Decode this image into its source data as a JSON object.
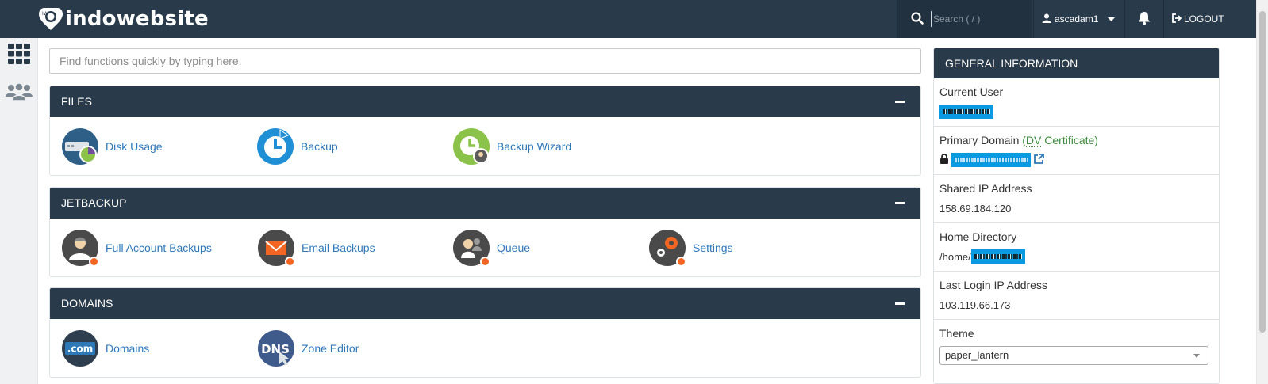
{
  "brand": {
    "name": "indowebsite",
    "mark": "IW"
  },
  "topbar": {
    "search_placeholder": "Search ( / )",
    "user_name": "ascadam1",
    "logout_label": "LOGOUT"
  },
  "quick_search": {
    "placeholder": "Find functions quickly by typing here."
  },
  "groups": {
    "files": {
      "title": "FILES",
      "items": [
        {
          "label": "Disk Usage",
          "icon": "disk-usage-icon"
        },
        {
          "label": "Backup",
          "icon": "backup-icon"
        },
        {
          "label": "Backup Wizard",
          "icon": "backup-wizard-icon"
        }
      ]
    },
    "jetbackup": {
      "title": "JETBACKUP",
      "items": [
        {
          "label": "Full Account Backups",
          "icon": "full-account-backups-icon"
        },
        {
          "label": "Email Backups",
          "icon": "email-backups-icon"
        },
        {
          "label": "Queue",
          "icon": "queue-icon"
        },
        {
          "label": "Settings",
          "icon": "settings-icon"
        }
      ]
    },
    "domains": {
      "title": "DOMAINS",
      "items": [
        {
          "label": "Domains",
          "icon": "domains-icon",
          "icon_text": ".com"
        },
        {
          "label": "Zone Editor",
          "icon": "zone-editor-icon",
          "icon_text": "DNS"
        }
      ]
    }
  },
  "general_info": {
    "title": "GENERAL INFORMATION",
    "current_user_label": "Current User",
    "primary_domain_label": "Primary Domain",
    "primary_domain_cert_open": "(",
    "primary_domain_cert_abbr": "DV",
    "primary_domain_cert_rest": " Certificate)",
    "shared_ip_label": "Shared IP Address",
    "shared_ip_value": "158.69.184.120",
    "home_dir_label": "Home Directory",
    "home_dir_prefix": "/home/",
    "last_login_label": "Last Login IP Address",
    "last_login_value": "103.119.66.173",
    "theme_label": "Theme",
    "theme_value": "paper_lantern"
  },
  "colors": {
    "navbar": "#293a4a",
    "panel_header": "#293a4a",
    "link": "#2f79b9",
    "redaction": "#0a9ae1",
    "dv_green": "#3d8b3d",
    "jetbackup_badge": "#f26522"
  }
}
